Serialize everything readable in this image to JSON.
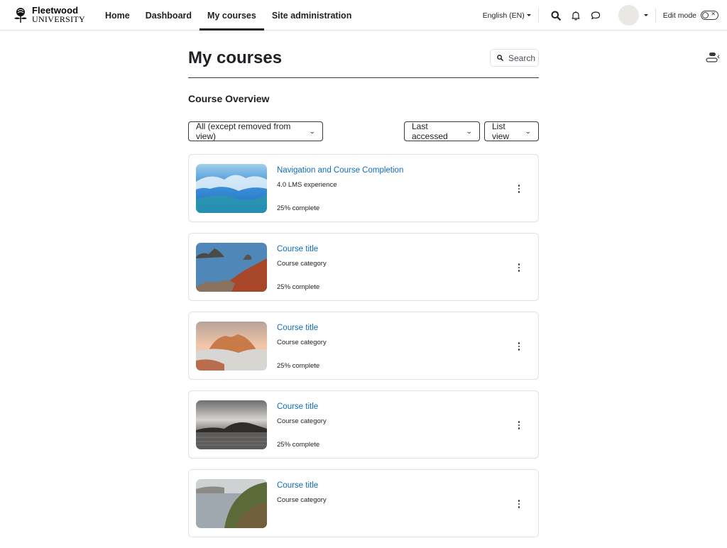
{
  "brand": {
    "name_line1": "Fleetwood",
    "name_line2": "UNIVERSITY",
    "logo_icon": "rose-crest-icon"
  },
  "nav": {
    "items": [
      {
        "label": "Home",
        "active": false
      },
      {
        "label": "Dashboard",
        "active": false
      },
      {
        "label": "My courses",
        "active": true
      },
      {
        "label": "Site administration",
        "active": false
      }
    ]
  },
  "usermenu": {
    "language": "English (EN)",
    "search_icon": "search-icon",
    "notifications_icon": "bell-icon",
    "messages_icon": "chat-bubble-icon",
    "edit_mode_label": "Edit mode",
    "edit_mode_on": false
  },
  "page": {
    "title": "My courses",
    "search_label": "Search",
    "section_title": "Course Overview"
  },
  "filters": {
    "grouping": "All (except removed from view)",
    "sort": "Last accessed",
    "view": "List view"
  },
  "courses": [
    {
      "title": "Navigation and Course Completion",
      "category": "4.0 LMS experience",
      "progress_text": "25% complete",
      "progress": 25,
      "image": "ocean-waves"
    },
    {
      "title": "Course title",
      "category": "Course category",
      "progress_text": "25% complete",
      "progress": 25,
      "image": "rocky-coast"
    },
    {
      "title": "Course title",
      "category": "Course category",
      "progress_text": "25% complete",
      "progress": 25,
      "image": "desert-rock"
    },
    {
      "title": "Course title",
      "category": "Course category",
      "progress_text": "25% complete",
      "progress": 25,
      "image": "stormy-lake"
    },
    {
      "title": "Course title",
      "category": "Course category",
      "progress_text": "",
      "progress": null,
      "image": "green-cliffs"
    }
  ],
  "colors": {
    "link": "#0f6cbf",
    "text": "#1d2125",
    "border": "#dee2e6"
  }
}
